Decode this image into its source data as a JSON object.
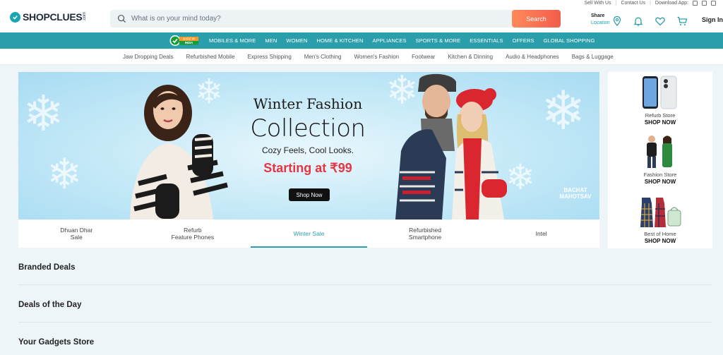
{
  "header": {
    "logo_text": "SHOPCLUES",
    "logo_suffix": ".com",
    "search_placeholder": "What is on your mind today?",
    "search_button": "Search",
    "top_links": [
      "Sell With Us",
      "Contact Us",
      "Download App:"
    ],
    "share_label": "Share",
    "location_label": "Location",
    "signin_label": "Sign In"
  },
  "nav": {
    "made_in_india_line1": "MADE IN",
    "made_in_india_line2": "INDIA",
    "items": [
      "MOBILES & MORE",
      "MEN",
      "WOMEN",
      "HOME & KITCHEN",
      "APPLIANCES",
      "SPORTS & MORE",
      "ESSENTIALS",
      "OFFERS",
      "GLOBAL SHOPPING"
    ]
  },
  "subnav": {
    "items": [
      "Jaw Dropping Deals",
      "Refurbished Mobile",
      "Express Shipping",
      "Men's Clothing",
      "Women's Fashion",
      "Footwear",
      "Kitchen & Dinning",
      "Audio & Headphones",
      "Bags & Luggage"
    ]
  },
  "banner": {
    "title_line1": "Winter Fashion",
    "title_line2": "Collection",
    "subtitle": "Cozy Feels, Cool Looks.",
    "price": "Starting at ₹99",
    "cta": "Shop Now",
    "badge_line1": "BACHAT",
    "badge_line2": "MAHOTSAV"
  },
  "tabs": [
    {
      "line1": "Dhuan Dhar",
      "line2": "Sale",
      "active": false
    },
    {
      "line1": "Refurb",
      "line2": "Feature Phones",
      "active": false
    },
    {
      "line1": "Winter Sale",
      "line2": "",
      "active": true
    },
    {
      "line1": "Refurbished",
      "line2": "Smartphone",
      "active": false
    },
    {
      "line1": "Intel",
      "line2": "",
      "active": false
    }
  ],
  "stores": [
    {
      "name": "Refurb Store",
      "cta": "SHOP NOW",
      "icon": "phones-icon"
    },
    {
      "name": "Fashion Store",
      "cta": "SHOP NOW",
      "icon": "fashion-models-icon"
    },
    {
      "name": "Best of Home",
      "cta": "SHOP NOW",
      "icon": "home-aprons-icon"
    }
  ],
  "sections": [
    "Branded Deals",
    "Deals of the Day",
    "Your Gadgets Store"
  ],
  "colors": {
    "brand_teal": "#2a9fab",
    "search_button": "#f25d4b",
    "price_red": "#e53542"
  }
}
